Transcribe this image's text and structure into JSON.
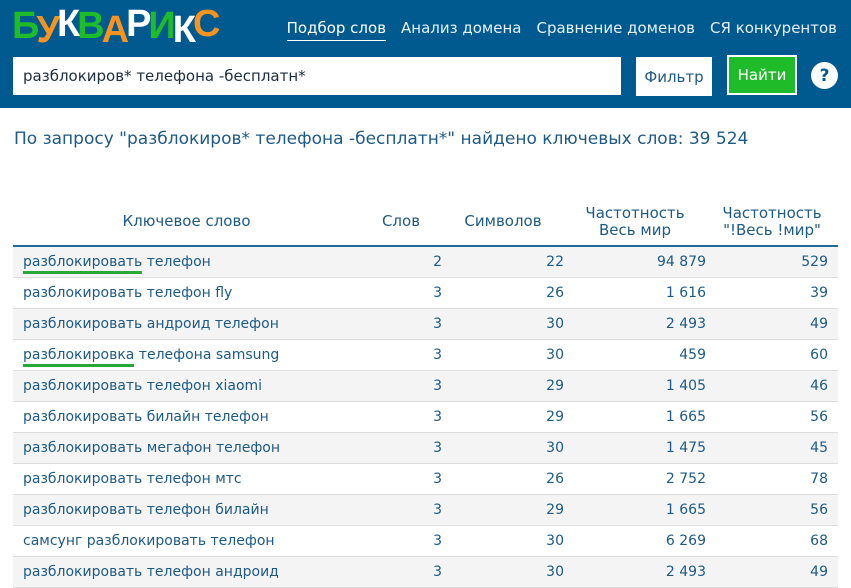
{
  "logo": {
    "letters": [
      "Б",
      "У",
      "К",
      "В",
      "А",
      "Р",
      "И",
      "К",
      "С"
    ],
    "colors": [
      "#1fbc2a",
      "#f7931e",
      "#ffffff",
      "#1fbc2a",
      "#f7931e",
      "#ffffff",
      "#1fbc2a",
      "#ffffff",
      "#f7931e"
    ]
  },
  "nav": [
    "Подбор слов",
    "Анализ домена",
    "Сравнение доменов",
    "СЯ конкурентов"
  ],
  "search": {
    "value": "разблокиров* телефона -бесплатн*"
  },
  "filter_label": "Фильтр",
  "find_label": "Найти",
  "help_label": "?",
  "result_text": "По запросу \"разблокиров* телефона -бесплатн*\" найдено ключевых слов: 39 524",
  "columns": [
    "Ключевое слово",
    "Слов",
    "Символов",
    "Частотность\nВесь мир",
    "Частотность\n\"!Весь !мир\""
  ],
  "col_h": {
    "c3a": "Частотность",
    "c3b": "Весь мир",
    "c4a": "Частотность",
    "c4b": "\"!Весь !мир\""
  },
  "rows": [
    {
      "u": "разблокировать",
      "rest": " телефон",
      "w": "2",
      "c": "22",
      "f": "94 879",
      "e": "529"
    },
    {
      "u": "",
      "rest": "разблокировать телефон fly",
      "w": "3",
      "c": "26",
      "f": "1 616",
      "e": "39"
    },
    {
      "u": "",
      "rest": "разблокировать андроид телефон",
      "w": "3",
      "c": "30",
      "f": "2 493",
      "e": "49"
    },
    {
      "u": "разблокировка",
      "rest": " телефона samsung",
      "w": "3",
      "c": "30",
      "f": "459",
      "e": "60"
    },
    {
      "u": "",
      "rest": "разблокировать телефон xiaomi",
      "w": "3",
      "c": "29",
      "f": "1 405",
      "e": "46"
    },
    {
      "u": "",
      "rest": "разблокировать билайн телефон",
      "w": "3",
      "c": "29",
      "f": "1 665",
      "e": "56"
    },
    {
      "u": "",
      "rest": "разблокировать мегафон телефон",
      "w": "3",
      "c": "30",
      "f": "1 475",
      "e": "45"
    },
    {
      "u": "",
      "rest": "разблокировать телефон мтс",
      "w": "3",
      "c": "26",
      "f": "2 752",
      "e": "78"
    },
    {
      "u": "",
      "rest": "разблокировать телефон билайн",
      "w": "3",
      "c": "29",
      "f": "1 665",
      "e": "56"
    },
    {
      "u": "",
      "rest": "самсунг разблокировать телефон",
      "w": "3",
      "c": "30",
      "f": "6 269",
      "e": "68"
    },
    {
      "u": "",
      "rest": "разблокировать телефон андроид",
      "w": "3",
      "c": "30",
      "f": "2 493",
      "e": "49"
    }
  ]
}
